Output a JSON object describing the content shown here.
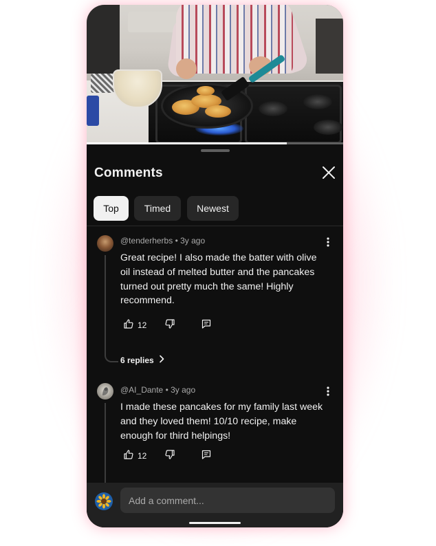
{
  "video": {
    "progress_fraction": 0.78
  },
  "sheet": {
    "title": "Comments",
    "close_icon": "close-icon"
  },
  "sort_chips": [
    {
      "label": "Top",
      "active": true
    },
    {
      "label": "Timed",
      "active": false
    },
    {
      "label": "Newest",
      "active": false
    }
  ],
  "comments": [
    {
      "handle": "@tenderherbs",
      "age": "3y ago",
      "text": "Great recipe! I also made the batter with olive oil instead of melted butter and the pancakes turned out pretty much the same! Highly recommend.",
      "likes": "12",
      "replies_label": "6 replies"
    },
    {
      "handle": "@AI_Dante",
      "age": "3y ago",
      "text": "I made these pancakes for my family last week and they loved them! 10/10 recipe, make enough for third helpings!",
      "likes": "12"
    }
  ],
  "composer": {
    "placeholder": "Add a comment..."
  },
  "colors": {
    "background": "#0f0f0f",
    "chip_inactive": "#272727",
    "chip_active": "#f1f1f1",
    "text_primary": "#f1f1f1",
    "text_secondary": "#aaaaaa",
    "glow": "#ff7896"
  }
}
